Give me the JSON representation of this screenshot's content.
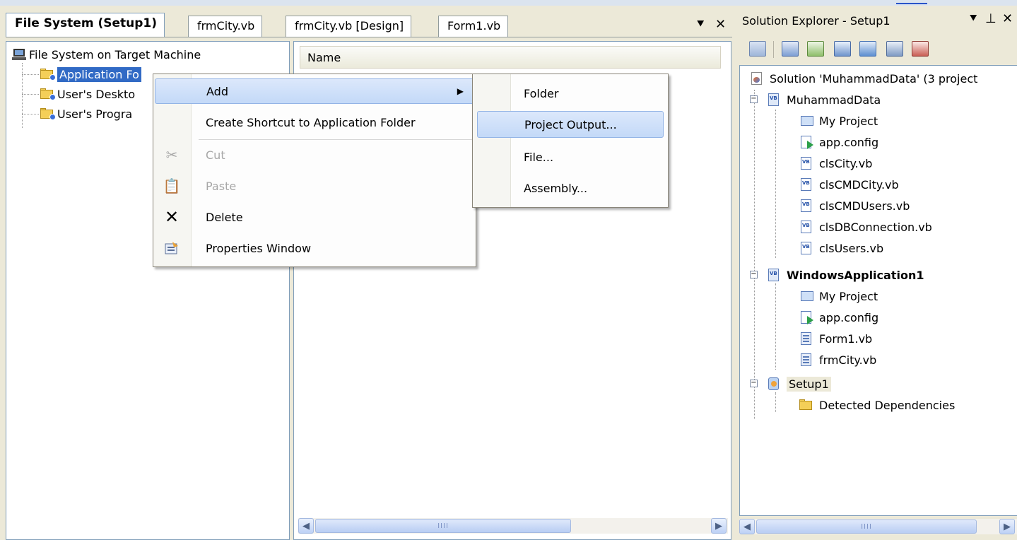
{
  "tabs": [
    {
      "label": "File System (Setup1)",
      "active": true
    },
    {
      "label": "frmCity.vb",
      "active": false
    },
    {
      "label": "frmCity.vb [Design]",
      "active": false
    },
    {
      "label": "Form1.vb",
      "active": false
    }
  ],
  "doc_controls": {
    "dropdown": "⯆",
    "close": "✕"
  },
  "fs_tree": {
    "root": "File System on Target Machine",
    "items": [
      "Application Fo",
      "User's Deskto",
      "User's Progra"
    ]
  },
  "list": {
    "column_name": "Name"
  },
  "context_menu": {
    "add": "Add",
    "create_shortcut": "Create Shortcut to Application Folder",
    "cut": "Cut",
    "paste": "Paste",
    "delete": "Delete",
    "properties": "Properties Window"
  },
  "submenu": {
    "folder": "Folder",
    "project_output": "Project Output...",
    "file": "File...",
    "assembly": "Assembly..."
  },
  "solution_explorer": {
    "title": "Solution Explorer - Setup1",
    "solution": "Solution 'MuhammadData' (3 project",
    "projects": [
      {
        "name": "MuhammadData",
        "files": [
          "My Project",
          "app.config",
          "clsCity.vb",
          "clsCMDCity.vb",
          "clsCMDUsers.vb",
          "clsDBConnection.vb",
          "clsUsers.vb"
        ]
      },
      {
        "name": "WindowsApplication1",
        "files": [
          "My Project",
          "app.config",
          "Form1.vb",
          "frmCity.vb"
        ]
      },
      {
        "name": "Setup1",
        "files": [
          "Detected Dependencies"
        ]
      }
    ]
  },
  "scroll": {
    "thumb_grip": "IIII"
  },
  "colors": {
    "selection": "#316ac5",
    "menu_highlight": "#c3d9f8",
    "chrome": "#ece9d8"
  }
}
